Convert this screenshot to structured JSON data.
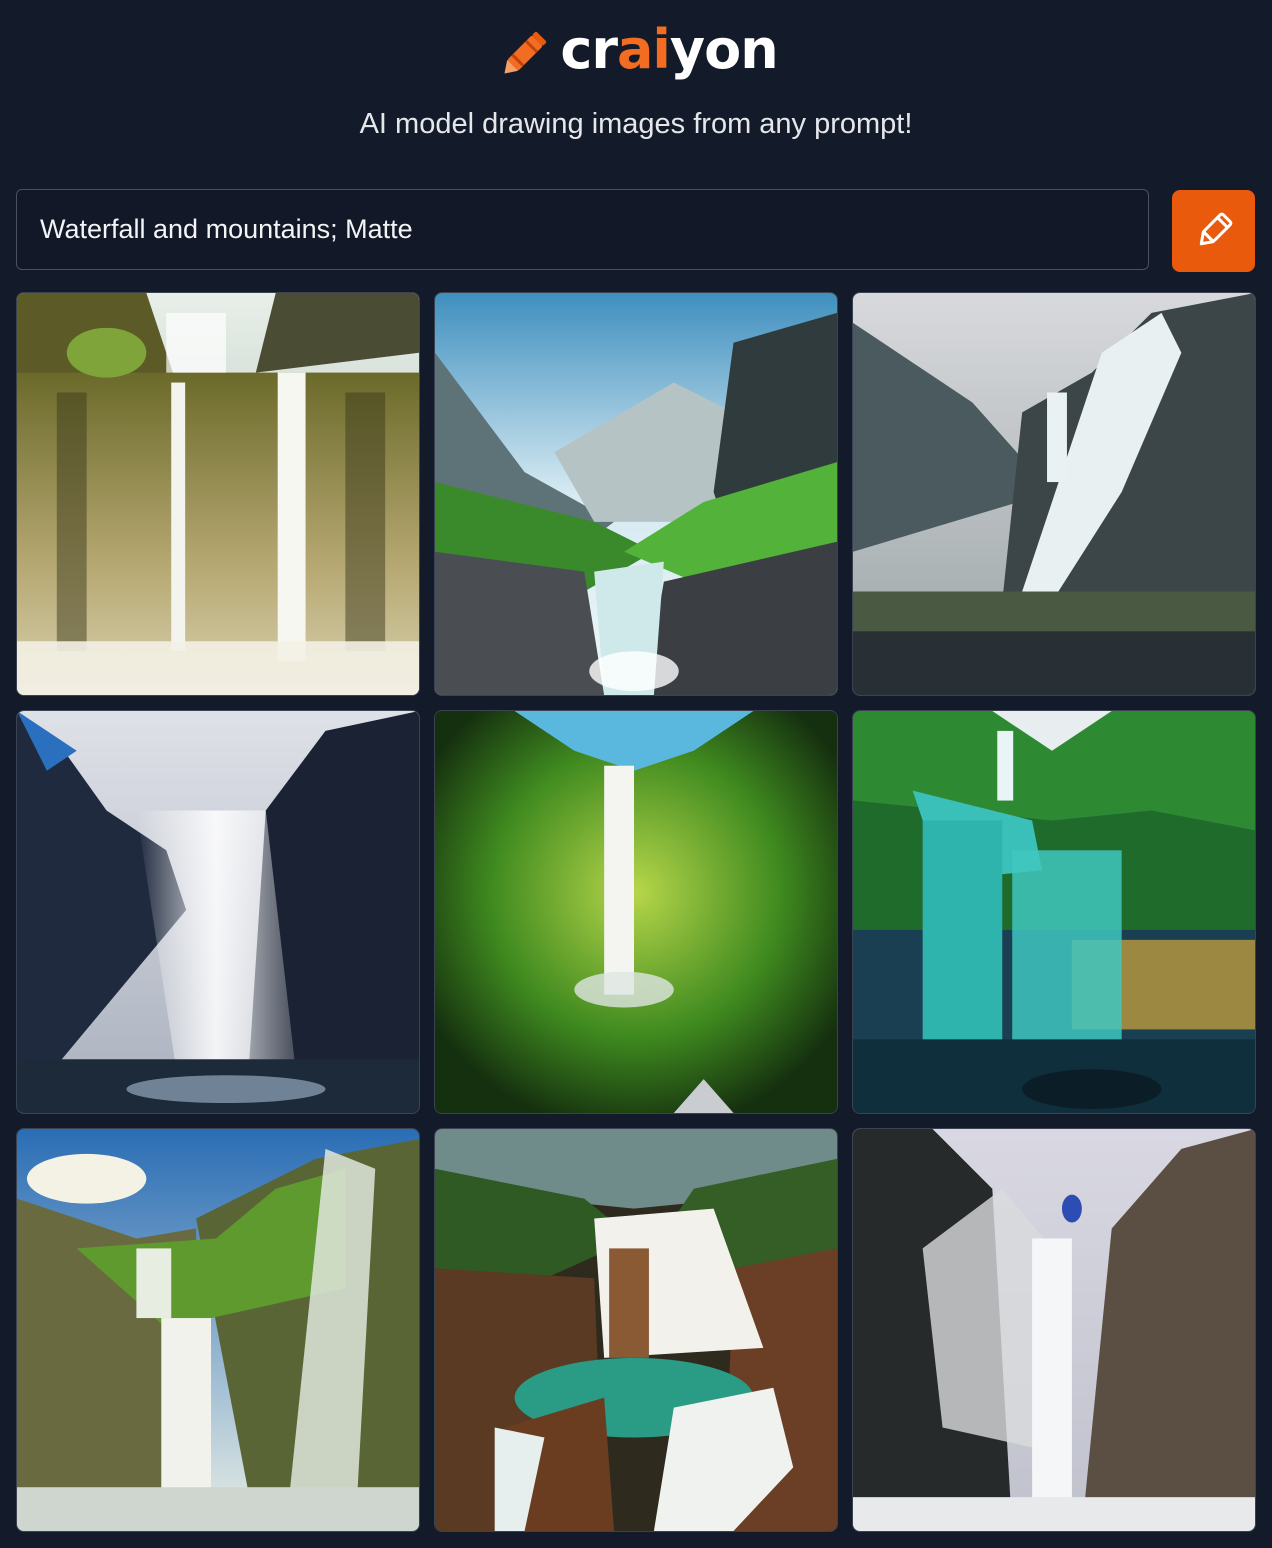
{
  "brand": {
    "name_parts": [
      "cr",
      "ai",
      "yon"
    ],
    "accent_color": "#f26c22",
    "logo_icon": "crayon-icon"
  },
  "subtitle": "AI model drawing images from any prompt!",
  "prompt": {
    "value": "Waterfall and mountains; Matte",
    "placeholder": ""
  },
  "draw_button": {
    "icon": "pencil-icon",
    "color": "#ea5a0c"
  },
  "results": {
    "images": [
      {
        "scene": "twin-waterfall-cliff"
      },
      {
        "scene": "mountain-valley-stream"
      },
      {
        "scene": "misty-mountain-waterfall"
      },
      {
        "scene": "dark-canyon-waterfall"
      },
      {
        "scene": "green-valley-waterfall"
      },
      {
        "scene": "turquoise-jungle-waterfall"
      },
      {
        "scene": "mossy-canyon-waterfall"
      },
      {
        "scene": "rocky-pool-waterfall"
      },
      {
        "scene": "monochrome-cliff-waterfall"
      }
    ]
  }
}
